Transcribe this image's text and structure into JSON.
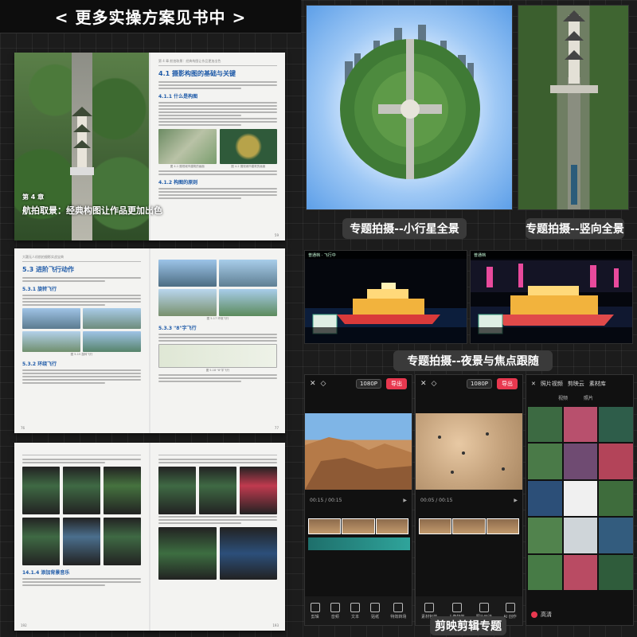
{
  "banner": {
    "title": "< 更多实操方案见书中 >"
  },
  "spread1": {
    "runhead_right": "第 4 章  航拍取景：经典构图让作品更加出色",
    "chapter_no": "第 4 章",
    "chapter_title": "航拍取景：经典构图让作品更加出色",
    "section_title": "4.1  摄影构图的基础与关键",
    "sub1": "4.1.1  什么是构图",
    "sub2": "4.1.2  构图的原则",
    "cap1": "图 4-1  展现城市建筑的画面",
    "cap2": "图 4-2  展现城市建筑的画面",
    "page_left": "58",
    "page_right": "59"
  },
  "spread2": {
    "runhead_left": "大疆无人机航拍摄影实战宝典",
    "section_title": "5.3  进阶飞行动作",
    "sub1": "5.3.1  旋转飞行",
    "sub2": "5.3.2  环绕飞行",
    "sub3": "5.3.3  \"8\"字飞行",
    "cap1": "图 5-15  旋转飞行",
    "cap2": "图 5-17  环绕飞行",
    "cap3": "图 5-18  \"8\"字飞行",
    "page_left": "76",
    "page_right": "77"
  },
  "spread3": {
    "sub1": "14.1.4  添加背景音乐",
    "page_left": "192",
    "page_right": "193"
  },
  "labels": {
    "planet": "专题拍摄--小行星全景",
    "vertical": "专题拍摄--竖向全景",
    "night": "专题拍摄--夜景与焦点跟随",
    "editing": "剪映剪辑专题"
  },
  "night_screens": {
    "mode_left": "普通档",
    "mode_right": "普通档",
    "status": "飞行中"
  },
  "app1": {
    "resolution": "1080P",
    "export": "导出",
    "time": "00:15 / 00:15",
    "tools": [
      "剪辑",
      "音频",
      "文本",
      "贴纸",
      "特效转场",
      "滤镜"
    ]
  },
  "app2": {
    "resolution": "1080P",
    "export": "导出",
    "time": "00:05 / 00:15",
    "tools": [
      "素材包装",
      "人像特效",
      "图片玩法",
      "AI 创作"
    ]
  },
  "app3": {
    "tabs": [
      "照片视频",
      "剪映云",
      "素材库"
    ],
    "subtabs": [
      "视频",
      "照片"
    ],
    "confirm": "高清"
  },
  "colors": {
    "accent": "#1e5aa8",
    "export": "#e8384f",
    "label_bg": "#3a3a3a"
  }
}
